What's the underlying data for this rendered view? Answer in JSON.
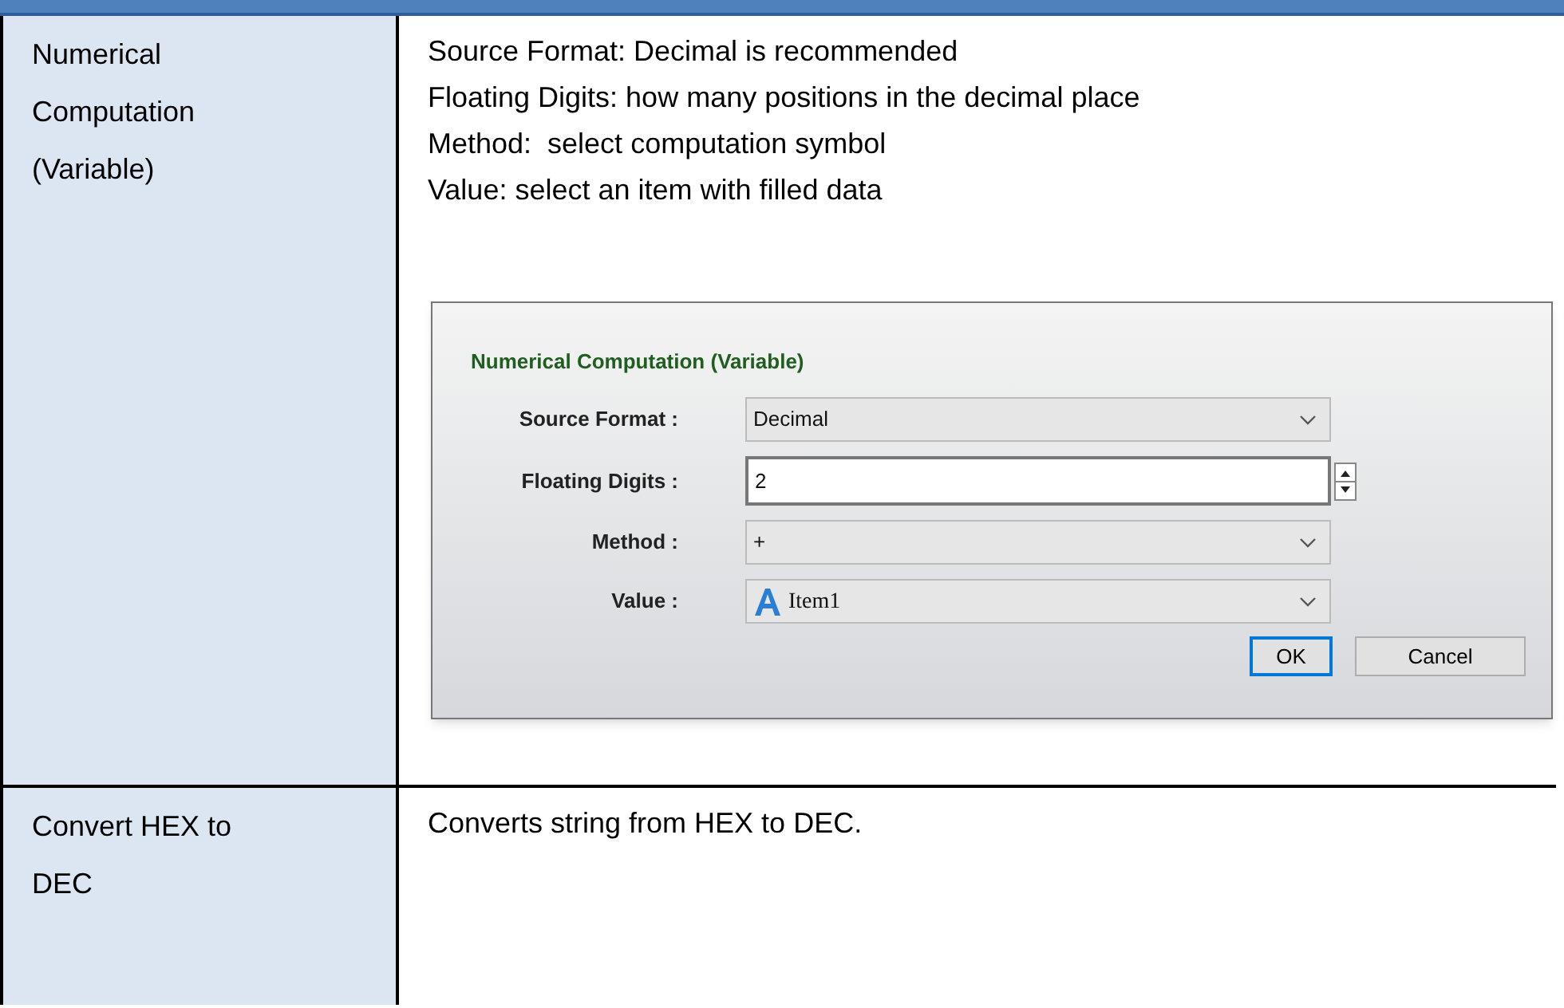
{
  "rows": [
    {
      "name": "Numerical Computation (Variable)",
      "description": [
        "Source Format: Decimal is recommended",
        "Floating Digits: how many positions in the decimal place",
        "Method:  select computation symbol",
        "Value: select an item with filled data"
      ],
      "dialog": {
        "title": "Numerical Computation (Variable)",
        "fields": [
          {
            "kind": "dropdown",
            "label": "Source Format :",
            "value": "Decimal"
          },
          {
            "kind": "spinner",
            "label": "Floating Digits :",
            "value": "2"
          },
          {
            "kind": "dropdown",
            "label": "Method :",
            "value": "+"
          },
          {
            "kind": "item-dropdown",
            "label": "Value :",
            "value": "Item1"
          }
        ],
        "buttons": [
          {
            "label": "OK",
            "selected": true
          },
          {
            "label": "Cancel",
            "selected": false
          }
        ]
      }
    },
    {
      "name": "Convert HEX to DEC",
      "description": [
        "Converts string from HEX to DEC."
      ]
    }
  ]
}
